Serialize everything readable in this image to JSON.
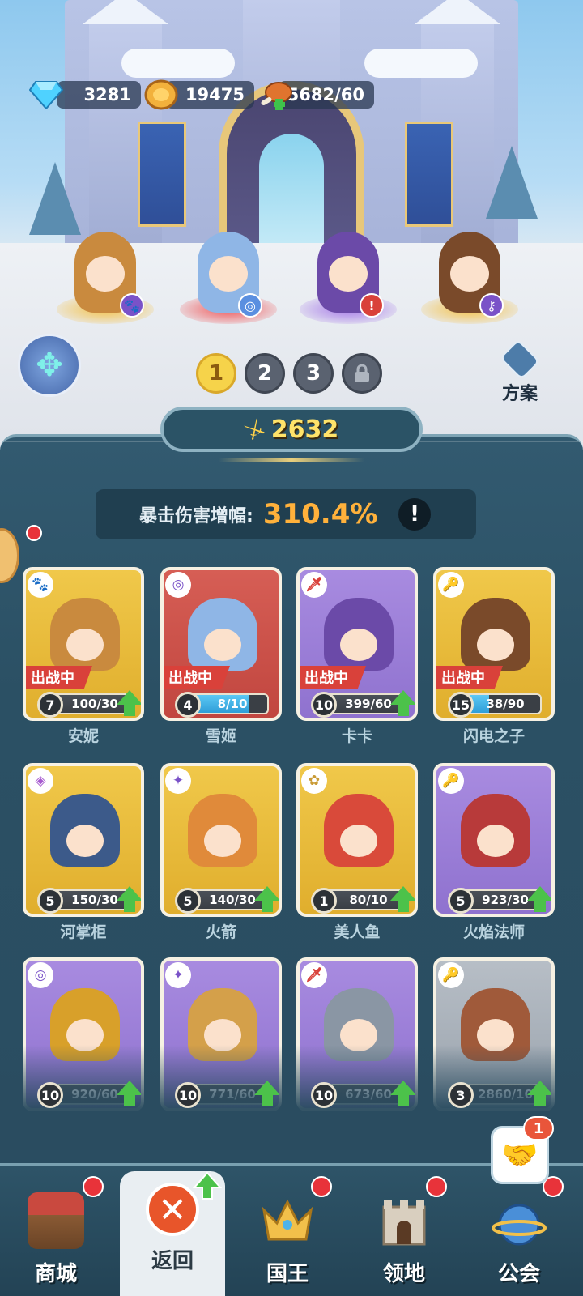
{
  "currency": {
    "gems": "3281",
    "gold": "19475",
    "stamina": "5682/60"
  },
  "icons": {
    "gem": "diamond-icon",
    "gold": "coin-icon",
    "stamina": "meat-icon",
    "dpad": "dpad-icon",
    "plan": "plan-icon",
    "power": "sword-icon",
    "info": "exclamation-icon",
    "lock": "lock-icon"
  },
  "formation_pages": [
    "1",
    "2",
    "3"
  ],
  "plan_label": "方案",
  "power": "2632",
  "crit": {
    "label": "暴击伤害增幅:",
    "value": "310.4%",
    "info": "!"
  },
  "deploy_tag": "出战中",
  "heroes": [
    {
      "name": "安妮",
      "level": "7",
      "progress": "100/30",
      "fill": 1.0,
      "class_glyph": "🐾",
      "class_color": "#7a52c8",
      "card": "gold"
    },
    {
      "name": "雪姬",
      "level": "4",
      "progress": "8/10",
      "fill": 0.8,
      "class_glyph": "◎",
      "class_color": "#7a52c8",
      "card": "red"
    },
    {
      "name": "卡卡",
      "level": "10",
      "progress": "399/60",
      "fill": 1.0,
      "class_glyph": "🗡",
      "class_color": "#d9413a",
      "card": "purple"
    },
    {
      "name": "闪电之子",
      "level": "15",
      "progress": "38/90",
      "fill": 0.42,
      "class_glyph": "🔑",
      "class_color": "#7a52c8",
      "card": "gold"
    },
    {
      "name": "河掌柜",
      "level": "5",
      "progress": "150/30",
      "fill": 1.0,
      "class_glyph": "◈",
      "class_color": "#a65ad0",
      "card": "gold"
    },
    {
      "name": "火箭",
      "level": "5",
      "progress": "140/30",
      "fill": 1.0,
      "class_glyph": "✦",
      "class_color": "#7a52c8",
      "card": "gold"
    },
    {
      "name": "美人鱼",
      "level": "1",
      "progress": "80/10",
      "fill": 1.0,
      "class_glyph": "✿",
      "class_color": "#c99b36",
      "card": "gold"
    },
    {
      "name": "火焰法师",
      "level": "5",
      "progress": "923/30",
      "fill": 1.0,
      "class_glyph": "🔑",
      "class_color": "#7a52c8",
      "card": "purple"
    },
    {
      "name": "",
      "level": "10",
      "progress": "920/60",
      "fill": 1.0,
      "class_glyph": "◎",
      "class_color": "#7a52c8",
      "card": "purple"
    },
    {
      "name": "",
      "level": "10",
      "progress": "771/60",
      "fill": 1.0,
      "class_glyph": "✦",
      "class_color": "#7a52c8",
      "card": "purple"
    },
    {
      "name": "",
      "level": "10",
      "progress": "673/60",
      "fill": 1.0,
      "class_glyph": "🗡",
      "class_color": "#d9413a",
      "card": "purple"
    },
    {
      "name": "",
      "level": "3",
      "progress": "2860/10",
      "fill": 1.0,
      "class_glyph": "🔑",
      "class_color": "#7a52c8",
      "card": "grey"
    }
  ],
  "nav": {
    "shop": "商城",
    "back": "返回",
    "king": "国王",
    "territory": "领地",
    "guild": "公会",
    "guild_count": "1"
  }
}
